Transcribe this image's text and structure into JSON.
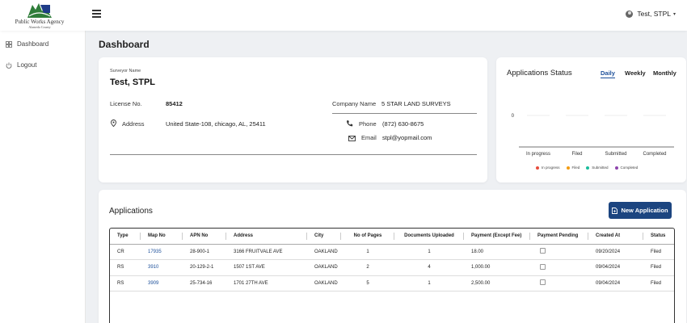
{
  "logo": {
    "text": "Public Works Agency",
    "subtext": "Alameda County"
  },
  "user": {
    "name": "Test, STPL"
  },
  "sidebar": {
    "items": [
      {
        "label": "Dashboard",
        "icon": "grid-icon"
      },
      {
        "label": "Logout",
        "icon": "power-icon"
      }
    ]
  },
  "page": {
    "title": "Dashboard"
  },
  "surveyor": {
    "name_label": "Surveyor Name",
    "name": "Test, STPL",
    "license_label": "License No.",
    "license": "85412",
    "company_label": "Company Name",
    "company": "5 STAR LAND SURVEYS",
    "address_label": "Address",
    "address": "United State-108, chicago, AL, 25411",
    "phone_label": "Phone",
    "phone": "(872) 630-8675",
    "email_label": "Email",
    "email": "stpl@yopmail.com"
  },
  "status": {
    "title": "Applications Status",
    "tabs": [
      "Daily",
      "Weekly",
      "Monthly"
    ],
    "active_tab": "Daily"
  },
  "chart_data": {
    "type": "bar",
    "categories": [
      "In progress",
      "Filed",
      "Submitted",
      "Completed"
    ],
    "values": [
      0,
      0,
      0,
      0
    ],
    "ytick": "0",
    "series_colors": [
      "#e74c3c",
      "#f39c12",
      "#1abc9c",
      "#8e44ad"
    ],
    "legend": [
      "In progress",
      "Filed",
      "Submitted",
      "Completed"
    ],
    "legend_position": "bottom"
  },
  "applications": {
    "title": "Applications",
    "new_button": "New Application",
    "columns": [
      "Type",
      "Map No",
      "APN No",
      "Address",
      "City",
      "No of Pages",
      "Documents Uploaded",
      "Payment (Except Fee)",
      "Payment Pending",
      "Created At",
      "Status"
    ],
    "rows": [
      {
        "type": "CR",
        "map_no": "17935",
        "apn_no": "28-900-1",
        "address": "3166 FRUITVALE AVE",
        "city": "OAKLAND",
        "pages": "1",
        "docs": "1",
        "payment": "18.00",
        "pending": false,
        "created": "09/20/2024",
        "status": "Filed"
      },
      {
        "type": "RS",
        "map_no": "3910",
        "apn_no": "20-129-2-1",
        "address": "1507 1ST AVE",
        "city": "OAKLAND",
        "pages": "2",
        "docs": "4",
        "payment": "1,000.00",
        "pending": false,
        "created": "09/04/2024",
        "status": "Filed"
      },
      {
        "type": "RS",
        "map_no": "3909",
        "apn_no": "25-734-16",
        "address": "1701 27TH AVE",
        "city": "OAKLAND",
        "pages": "5",
        "docs": "1",
        "payment": "2,500.00",
        "pending": false,
        "created": "09/04/2024",
        "status": "Filed"
      }
    ]
  }
}
